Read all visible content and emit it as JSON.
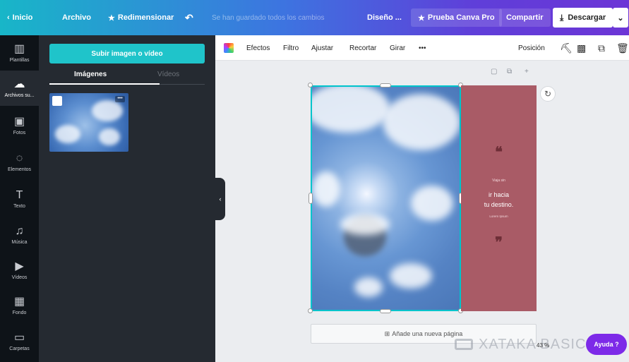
{
  "topbar": {
    "home": "Inicio",
    "file": "Archivo",
    "resize": "Redimensionar",
    "undo_glyph": "↶",
    "saved": "Se han guardado todos los cambios",
    "design": "Diseño ...",
    "pro": "Prueba Canva Pro",
    "share": "Compartir",
    "download": "Descargar"
  },
  "rail": [
    {
      "label": "Plantillas",
      "glyph": "▥"
    },
    {
      "label": "Archivos su...",
      "glyph": "☁"
    },
    {
      "label": "Fotos",
      "glyph": "▣"
    },
    {
      "label": "Elementos",
      "glyph": "◌"
    },
    {
      "label": "Texto",
      "glyph": "T"
    },
    {
      "label": "Música",
      "glyph": "♫"
    },
    {
      "label": "Vídeos",
      "glyph": "▶"
    },
    {
      "label": "Fondo",
      "glyph": "▦"
    },
    {
      "label": "Carpetas",
      "glyph": "▭"
    }
  ],
  "panel": {
    "upload": "Subir imagen o vídeo",
    "tab_images": "Imágenes",
    "tab_videos": "Vídeos",
    "thumb_more": "•••"
  },
  "editor_toolbar": {
    "effects": "Efectos",
    "filter": "Filtro",
    "adjust": "Ajustar",
    "crop": "Recortar",
    "rotate": "Girar",
    "more": "•••",
    "position": "Posición"
  },
  "quote": {
    "small": "Viaja sin",
    "line1": "ir hacia",
    "line2": "tu destino.",
    "author": "Lorem Ipsum"
  },
  "canvas": {
    "add_page": "Añade una nueva página",
    "zoom": "43 %"
  },
  "watermark": "XATAKA BASICS",
  "help": "Ayuda ?",
  "colors": {
    "accent": "#00c4cc",
    "quote_bg": "#a95b66",
    "help": "#7d2ae8"
  }
}
